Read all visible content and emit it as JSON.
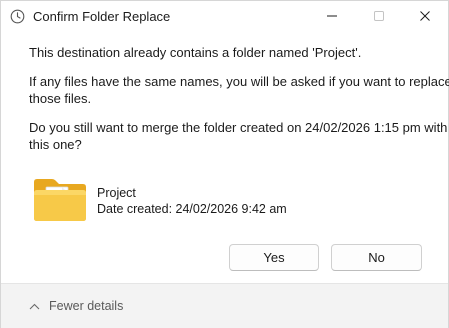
{
  "window": {
    "title": "Confirm Folder Replace"
  },
  "message": {
    "line1": "This destination already contains a folder named 'Project'.",
    "line2": "If any files have the same names, you will be asked if you want to replace",
    "line3": "those files.",
    "line4": "Do you still want to merge the folder created on 24/02/2026 1:15 pm with",
    "line5": "this one?"
  },
  "folder": {
    "name": "Project",
    "date_created": "Date created: 24/02/2026 9:42 am",
    "icon": "folder-icon"
  },
  "buttons": {
    "yes": "Yes",
    "no": "No"
  },
  "footer": {
    "fewer_details": "Fewer details"
  },
  "colors": {
    "folder": "#f7c948",
    "footer_bg": "#f3f3f3"
  }
}
